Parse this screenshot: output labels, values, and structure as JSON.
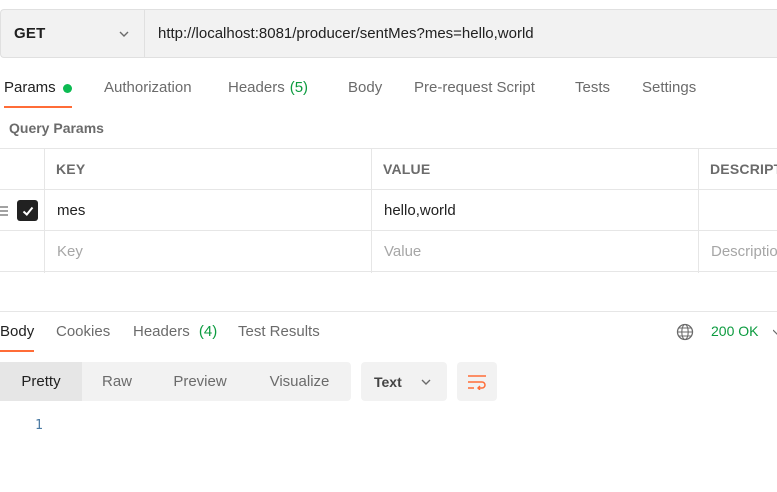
{
  "request": {
    "method": "GET",
    "url": "http://localhost:8081/producer/sentMes?mes=hello,world"
  },
  "request_tabs": [
    {
      "label": "Params",
      "active": true,
      "indicator": "green-dot"
    },
    {
      "label": "Authorization"
    },
    {
      "label": "Headers",
      "count": "(5)"
    },
    {
      "label": "Body"
    },
    {
      "label": "Pre-request Script"
    },
    {
      "label": "Tests"
    },
    {
      "label": "Settings"
    }
  ],
  "query_params": {
    "title": "Query Params",
    "columns": [
      "KEY",
      "VALUE",
      "DESCRIPT"
    ],
    "rows": [
      {
        "checked": true,
        "key": "mes",
        "value": "hello,world",
        "description": ""
      }
    ],
    "placeholder": {
      "key": "Key",
      "value": "Value",
      "description": "Descriptio"
    }
  },
  "response": {
    "tabs": [
      {
        "label": "Body",
        "active": true
      },
      {
        "label": "Cookies"
      },
      {
        "label": "Headers",
        "count": "(4)"
      },
      {
        "label": "Test Results"
      }
    ],
    "status": "200 OK",
    "view_modes": [
      "Pretty",
      "Raw",
      "Preview",
      "Visualize"
    ],
    "active_view": "Pretty",
    "format": "Text",
    "line_numbers": [
      "1"
    ]
  },
  "colors": {
    "accent": "#ff6c37",
    "success": "#0c9b3f",
    "indicator": "#0cbb52"
  },
  "icons": [
    "chevron-down-icon",
    "drag-handle-icon",
    "checkbox-checked-icon",
    "globe-icon",
    "wrap-lines-icon"
  ]
}
